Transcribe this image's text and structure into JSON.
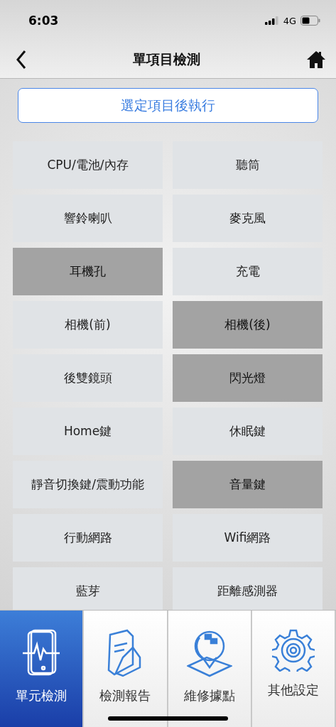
{
  "status_bar": {
    "time": "6:03",
    "network": "4G"
  },
  "header": {
    "title": "單項目檢測"
  },
  "run_button": {
    "label": "選定項目後執行"
  },
  "tests": [
    {
      "label": "CPU/電池/內存",
      "selected": false
    },
    {
      "label": "聽筒",
      "selected": false
    },
    {
      "label": "響鈴喇叭",
      "selected": false
    },
    {
      "label": "麥克風",
      "selected": false
    },
    {
      "label": "耳機孔",
      "selected": true
    },
    {
      "label": "充電",
      "selected": false
    },
    {
      "label": "相機(前)",
      "selected": false
    },
    {
      "label": "相機(後)",
      "selected": true
    },
    {
      "label": "後雙鏡頭",
      "selected": false
    },
    {
      "label": "閃光燈",
      "selected": true
    },
    {
      "label": "Home鍵",
      "selected": false
    },
    {
      "label": "休眠鍵",
      "selected": false
    },
    {
      "label": "靜音切換鍵/震動功能",
      "selected": false
    },
    {
      "label": "音量鍵",
      "selected": true
    },
    {
      "label": "行動網路",
      "selected": false
    },
    {
      "label": "Wifi網路",
      "selected": false
    },
    {
      "label": "藍芽",
      "selected": false
    },
    {
      "label": "距離感測器",
      "selected": false
    }
  ],
  "tab_bar": [
    {
      "label": "單元檢測",
      "kind": "phone",
      "selected": true
    },
    {
      "label": "檢測報告",
      "kind": "report",
      "selected": false
    },
    {
      "label": "維修據點",
      "kind": "location",
      "selected": false
    },
    {
      "label": "其他設定",
      "kind": "settings",
      "selected": false
    }
  ]
}
